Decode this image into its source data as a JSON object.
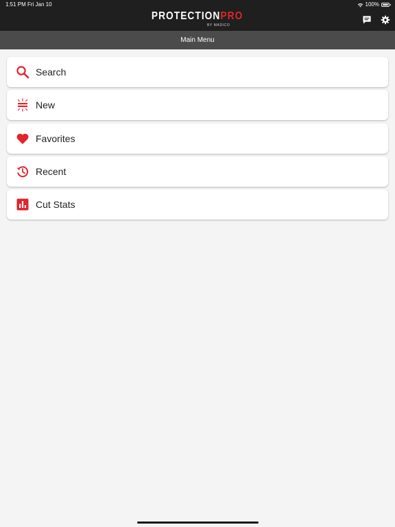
{
  "status_bar": {
    "time": "1:51 PM",
    "date": "Fri Jan 10",
    "battery": "100%",
    "icons": [
      "wifi-icon",
      "battery-icon"
    ]
  },
  "header": {
    "brand_primary": "PROTECTION",
    "brand_accent": "PRO",
    "brand_sub": "BY MADICO",
    "right_icons": [
      "message-icon",
      "settings-icon"
    ]
  },
  "subheader": {
    "title": "Main Menu"
  },
  "menu": {
    "items": [
      {
        "label": "Search",
        "icon": "search-icon"
      },
      {
        "label": "New",
        "icon": "new-icon"
      },
      {
        "label": "Favorites",
        "icon": "heart-icon"
      },
      {
        "label": "Recent",
        "icon": "history-icon"
      },
      {
        "label": "Cut Stats",
        "icon": "bar-chart-icon"
      }
    ]
  },
  "colors": {
    "accent": "#e0252b",
    "header_bg": "#1f1f1f",
    "subheader_bg": "#4b4b4b",
    "page_bg": "#f4f4f4"
  }
}
